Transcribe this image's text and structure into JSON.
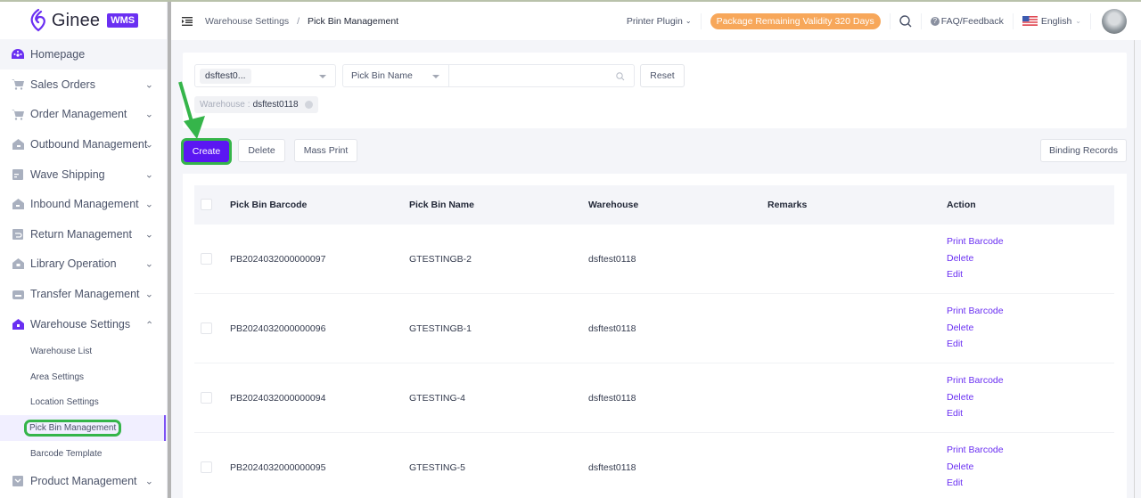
{
  "brand": {
    "name": "Ginee",
    "badge": "WMS",
    "accent": "#6a2ff2"
  },
  "sidebar": {
    "items": [
      {
        "label": "Homepage",
        "icon": "dashboard-icon",
        "expandable": false
      },
      {
        "label": "Sales Orders",
        "icon": "cart-icon",
        "expandable": true
      },
      {
        "label": "Order Management",
        "icon": "cart-icon",
        "expandable": true
      },
      {
        "label": "Outbound Management",
        "icon": "outbound-icon",
        "expandable": true
      },
      {
        "label": "Wave Shipping",
        "icon": "wave-icon",
        "expandable": true
      },
      {
        "label": "Inbound Management",
        "icon": "inbound-icon",
        "expandable": true
      },
      {
        "label": "Return Management",
        "icon": "return-icon",
        "expandable": true
      },
      {
        "label": "Library Operation",
        "icon": "library-icon",
        "expandable": true
      },
      {
        "label": "Transfer Management",
        "icon": "transfer-icon",
        "expandable": true
      },
      {
        "label": "Warehouse Settings",
        "icon": "warehouse-icon",
        "expandable": true,
        "expanded": true
      }
    ],
    "warehouse_sub": [
      {
        "label": "Warehouse List"
      },
      {
        "label": "Area Settings"
      },
      {
        "label": "Location Settings"
      },
      {
        "label": "Pick Bin Management",
        "selected": true
      },
      {
        "label": "Barcode Template"
      }
    ],
    "after": [
      {
        "label": "Product Management",
        "icon": "product-icon",
        "expandable": true
      }
    ]
  },
  "header": {
    "breadcrumb": {
      "parent": "Warehouse Settings",
      "separator": "/",
      "current": "Pick Bin Management"
    },
    "printer_plugin": "Printer Plugin",
    "package_badge": "Package Remaining Validity 320 Days",
    "faq": "FAQ/Feedback",
    "language": "English"
  },
  "filters": {
    "warehouse_tag": "dsftest0...",
    "field_select": "Pick Bin Name",
    "search_value": "",
    "search_placeholder": "",
    "reset_label": "Reset",
    "active_chip": {
      "key": "Warehouse",
      "sep": ":",
      "value": "dsftest0118"
    }
  },
  "toolbar": {
    "create": "Create",
    "delete": "Delete",
    "mass_print": "Mass Print",
    "binding_records": "Binding Records"
  },
  "table": {
    "columns": [
      "Pick Bin Barcode",
      "Pick Bin Name",
      "Warehouse",
      "Remarks",
      "Action"
    ],
    "actions": [
      "Print Barcode",
      "Delete",
      "Edit"
    ],
    "rows": [
      {
        "barcode": "PB2024032000000097",
        "name": "GTESTINGB-2",
        "warehouse": "dsftest0118",
        "remarks": ""
      },
      {
        "barcode": "PB2024032000000096",
        "name": "GTESTINGB-1",
        "warehouse": "dsftest0118",
        "remarks": ""
      },
      {
        "barcode": "PB2024032000000094",
        "name": "GTESTING-4",
        "warehouse": "dsftest0118",
        "remarks": ""
      },
      {
        "barcode": "PB2024032000000095",
        "name": "GTESTING-5",
        "warehouse": "dsftest0118",
        "remarks": ""
      }
    ]
  }
}
